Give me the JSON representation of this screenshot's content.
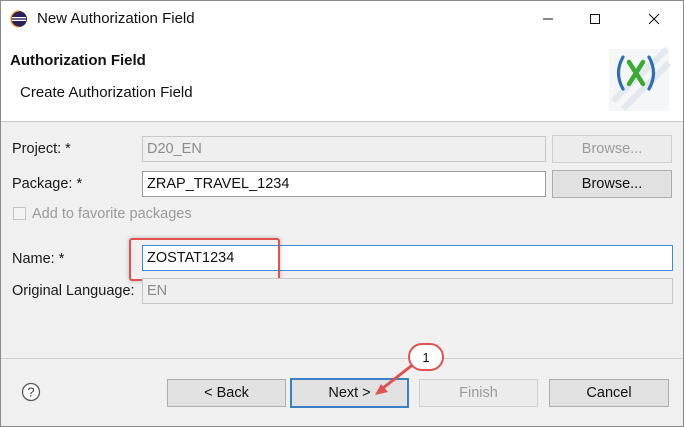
{
  "window": {
    "title": "New Authorization Field",
    "controls": {
      "minimize_icon": "minimize-icon",
      "maximize_icon": "maximize-icon",
      "close_icon": "close-icon"
    }
  },
  "header": {
    "title": "Authorization Field",
    "description": "Create Authorization Field",
    "logo_icon": "abap-x-logo"
  },
  "form": {
    "project": {
      "label": "Project: *",
      "value": "D20_EN",
      "browse_label": "Browse...",
      "enabled": false
    },
    "package": {
      "label": "Package: *",
      "value": "ZRAP_TRAVEL_1234",
      "browse_label": "Browse..."
    },
    "favorite": {
      "label": "Add to favorite packages",
      "checked": false,
      "enabled": false
    },
    "name": {
      "label": "Name: *",
      "value": "ZOSTAT1234"
    },
    "language": {
      "label": "Original Language:",
      "value": "EN",
      "enabled": false
    }
  },
  "footer": {
    "help_icon": "help-icon",
    "back_label": "< Back",
    "next_label": "Next >",
    "finish_label": "Finish",
    "cancel_label": "Cancel"
  },
  "annotation": {
    "callout_number": "1"
  },
  "colors": {
    "accent_red": "#e05252",
    "default_button_border": "#3c7fc4",
    "logo_green": "#3aaa35",
    "logo_blue": "#2f6db5"
  }
}
